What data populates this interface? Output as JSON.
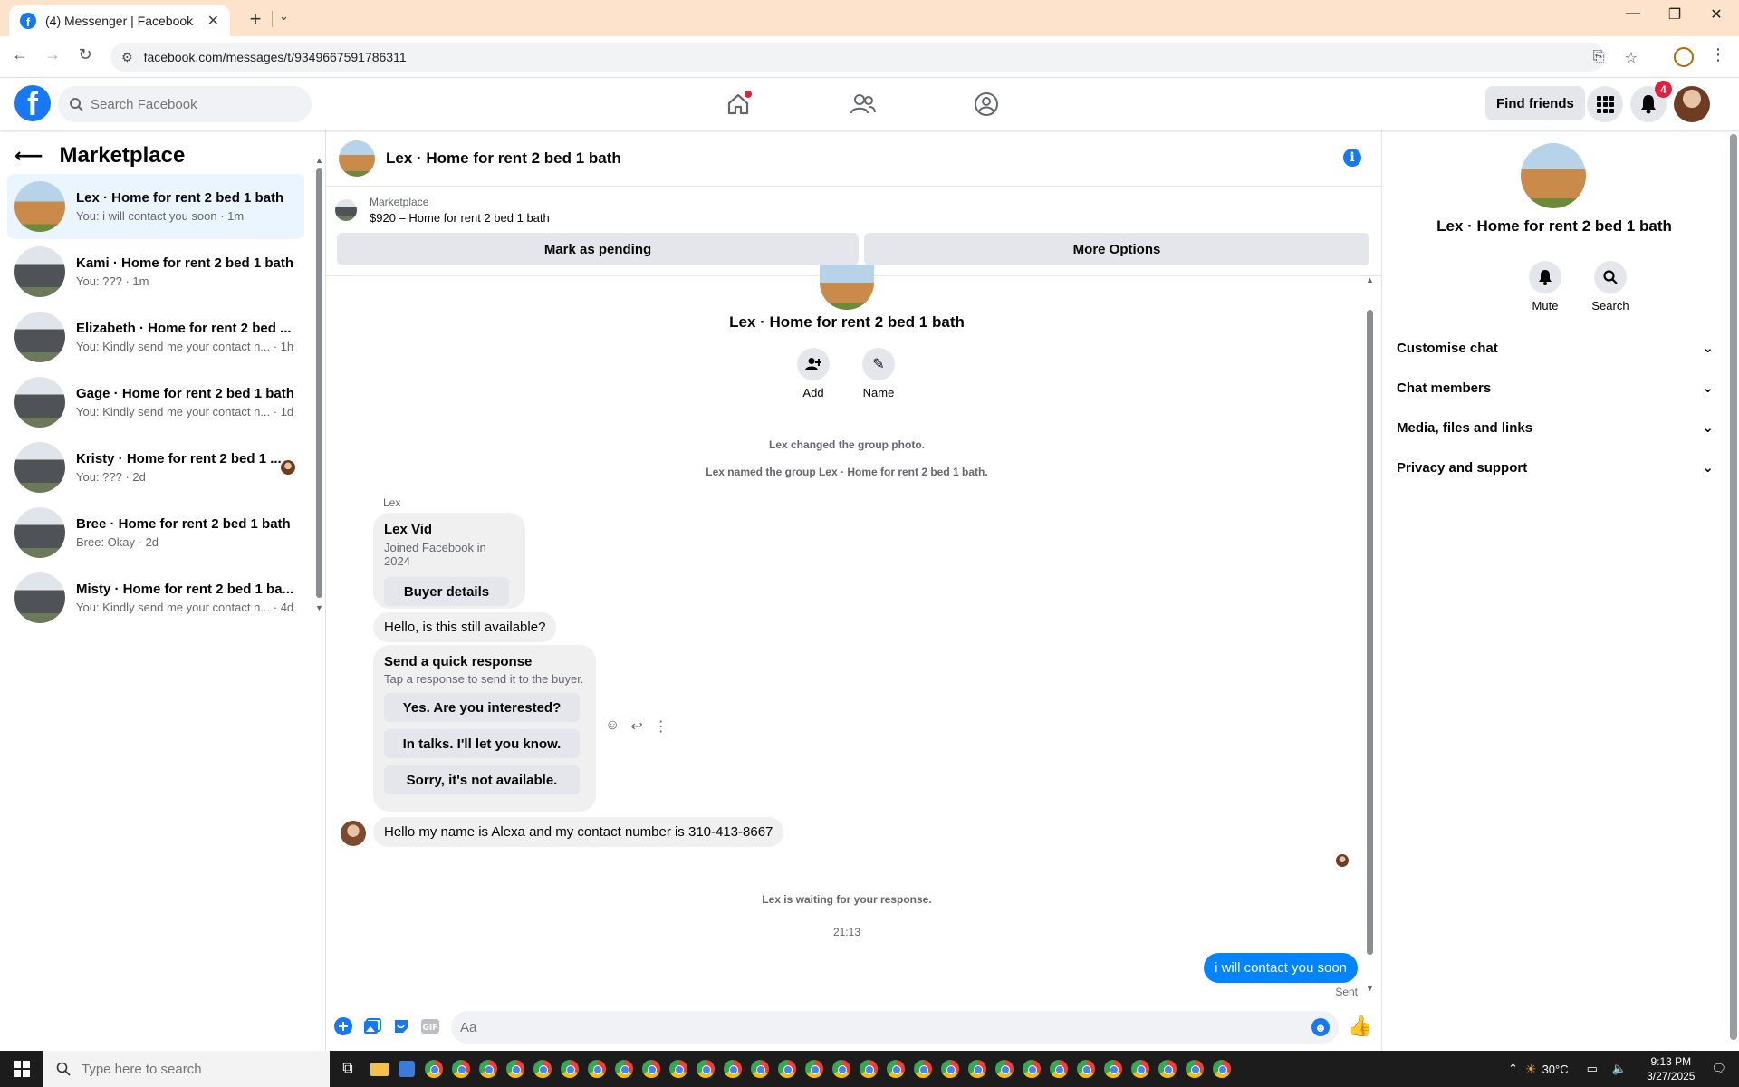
{
  "browser": {
    "tab_title": "(4) Messenger | Facebook",
    "url": "facebook.com/messages/t/9349667591786311"
  },
  "fb_header": {
    "search_placeholder": "Search Facebook",
    "find_friends": "Find friends",
    "notification_count": "4"
  },
  "sidebar": {
    "title": "Marketplace",
    "conversations": [
      {
        "name": "Lex · Home for rent 2 bed 1 bath",
        "snippet": "You: i will contact you soon · 1m",
        "thumb": "house-orange",
        "active": true
      },
      {
        "name": "Kami · Home for rent 2 bed 1 bath",
        "snippet": "You: ??? · 1m",
        "thumb": "house-grey"
      },
      {
        "name": "Elizabeth · Home for rent 2 bed ...",
        "snippet": "You: Kindly send me your contact n... · 1h",
        "thumb": "house-grey"
      },
      {
        "name": "Gage · Home for rent 2 bed 1 bath",
        "snippet": "You: Kindly send me your contact n... · 1d",
        "thumb": "house-grey"
      },
      {
        "name": "Kristy · Home for rent 2 bed 1 ...",
        "snippet": "You: ??? · 2d",
        "thumb": "house-grey"
      },
      {
        "name": "Bree · Home for rent 2 bed 1 bath",
        "snippet": "Bree: Okay · 2d",
        "thumb": "house-grey"
      },
      {
        "name": "Misty · Home for rent 2 bed 1 ba...",
        "snippet": "You: Kindly send me your contact n... · 4d",
        "thumb": "house-grey"
      }
    ]
  },
  "chat": {
    "title": "Lex · Home for rent 2 bed 1 bath",
    "marketplace_label": "Marketplace",
    "listing": "$920 – Home for rent 2 bed 1 bath",
    "mark_pending": "Mark as pending",
    "more_options": "More Options",
    "group_name": "Lex · Home for rent 2 bed 1 bath",
    "add_label": "Add",
    "name_label": "Name",
    "sys_photo": "Lex changed the group photo.",
    "sys_named": "Lex named the group Lex · Home for rent 2 bed 1 bath.",
    "sender": "Lex",
    "buyer_name": "Lex Vid",
    "buyer_joined": "Joined Facebook in 2024",
    "buyer_details": "Buyer details",
    "msg_available": "Hello, is this still available?",
    "quick_title": "Send a quick response",
    "quick_sub": "Tap a response to send it to the buyer.",
    "quick_responses": [
      "Yes. Are you interested?",
      "In talks. I'll let you know.",
      "Sorry, it's not available."
    ],
    "msg_alexa": "Hello my name is Alexa and my contact number is 310-413-8667",
    "waiting": "Lex is waiting for your response.",
    "time": "21:13",
    "out_msg": "i will contact you soon",
    "sent": "Sent",
    "composer_placeholder": "Aa"
  },
  "rpanel": {
    "name": "Lex · Home for rent 2 bed 1 bath",
    "mute": "Mute",
    "search": "Search",
    "rows": [
      "Customise chat",
      "Chat members",
      "Media, files and links",
      "Privacy and support"
    ]
  },
  "taskbar": {
    "search_placeholder": "Type here to search",
    "temp": "30°C",
    "time": "9:13 PM",
    "date": "3/27/2025"
  },
  "colors": {
    "fb_blue": "#1877f2",
    "messenger_blue": "#0084ff",
    "tab_bar": "#fde3cc"
  }
}
